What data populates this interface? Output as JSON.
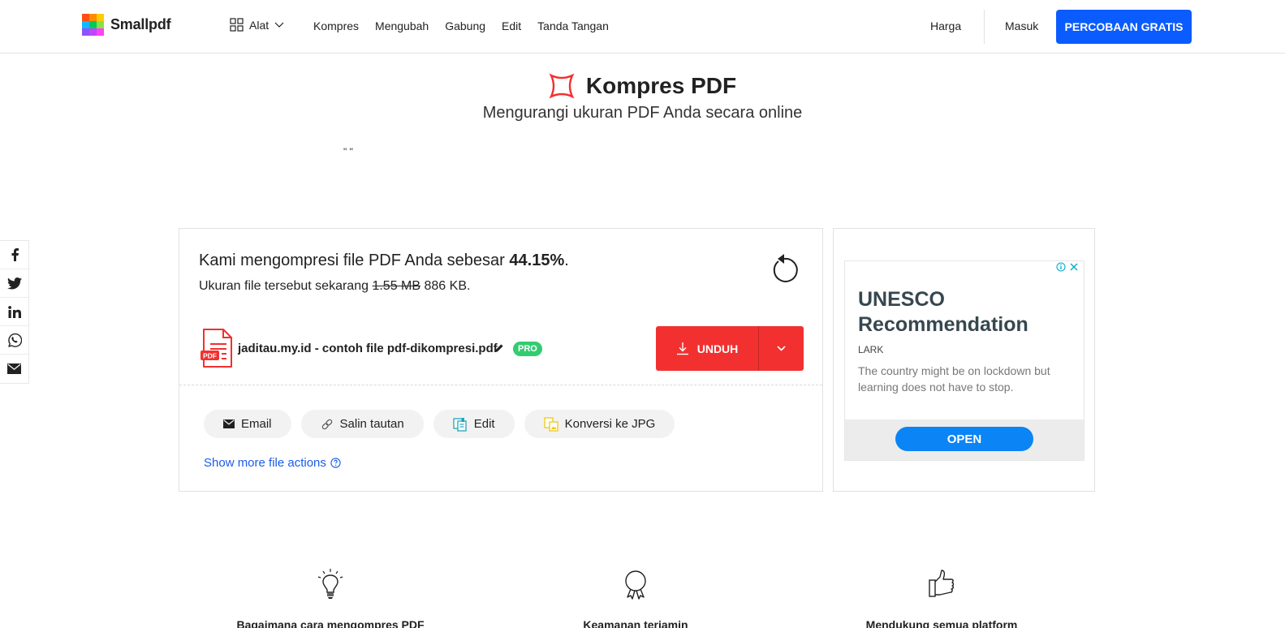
{
  "header": {
    "logo_text": "Smallpdf",
    "logo_colors": [
      "#ff4f14",
      "#ff8c00",
      "#ffcc00",
      "#15b8ff",
      "#00c85a",
      "#8ae046",
      "#9051ff",
      "#c144ff",
      "#ff42f5"
    ],
    "tools_label": "Alat",
    "nav": [
      "Kompres",
      "Mengubah",
      "Gabung",
      "Edit",
      "Tanda Tangan"
    ],
    "pricing_label": "Harga",
    "login_label": "Masuk",
    "trial_label": "PERCOBAAN GRATIS",
    "accent_color": "#0b5cff"
  },
  "page": {
    "title": "Kompres PDF",
    "subtitle": "Mengurangi ukuran PDF Anda secara online",
    "stray_text": "\" \""
  },
  "result": {
    "message_prefix": "Kami mengompresi file PDF Anda sebesar ",
    "percent": "44.15%",
    "message_suffix": ".",
    "size_prefix": "Ukuran file tersebut sekarang ",
    "old_size": "1.55 MB",
    "new_size": "886 KB.",
    "file_name": "jaditau.my.id - contoh file pdf-dikompresi.pdf",
    "file_badge": "PDF",
    "pro_badge": "PRO",
    "download_label": "UNDUH",
    "download_color": "#f23030"
  },
  "actions": [
    {
      "label": "Email",
      "icon": "envelope-icon"
    },
    {
      "label": "Salin tautan",
      "icon": "link-icon"
    },
    {
      "label": "Edit",
      "icon": "edit-document-icon"
    },
    {
      "label": "Konversi ke JPG",
      "icon": "convert-jpg-icon"
    }
  ],
  "more_actions_label": "Show more file actions",
  "ad": {
    "title": "UNESCO Recommendation",
    "brand": "LARK",
    "description": "The country might be on lockdown but learning does not have to stop.",
    "cta": "OPEN"
  },
  "share": [
    "facebook-icon",
    "twitter-icon",
    "linkedin-icon",
    "whatsapp-icon",
    "email-icon"
  ],
  "features": [
    {
      "title": "Bagaimana cara mengompres PDF",
      "icon": "lightbulb-icon"
    },
    {
      "title": "Keamanan terjamin",
      "icon": "award-ribbon-icon"
    },
    {
      "title": "Mendukung semua platform",
      "icon": "thumbs-up-icon"
    }
  ]
}
